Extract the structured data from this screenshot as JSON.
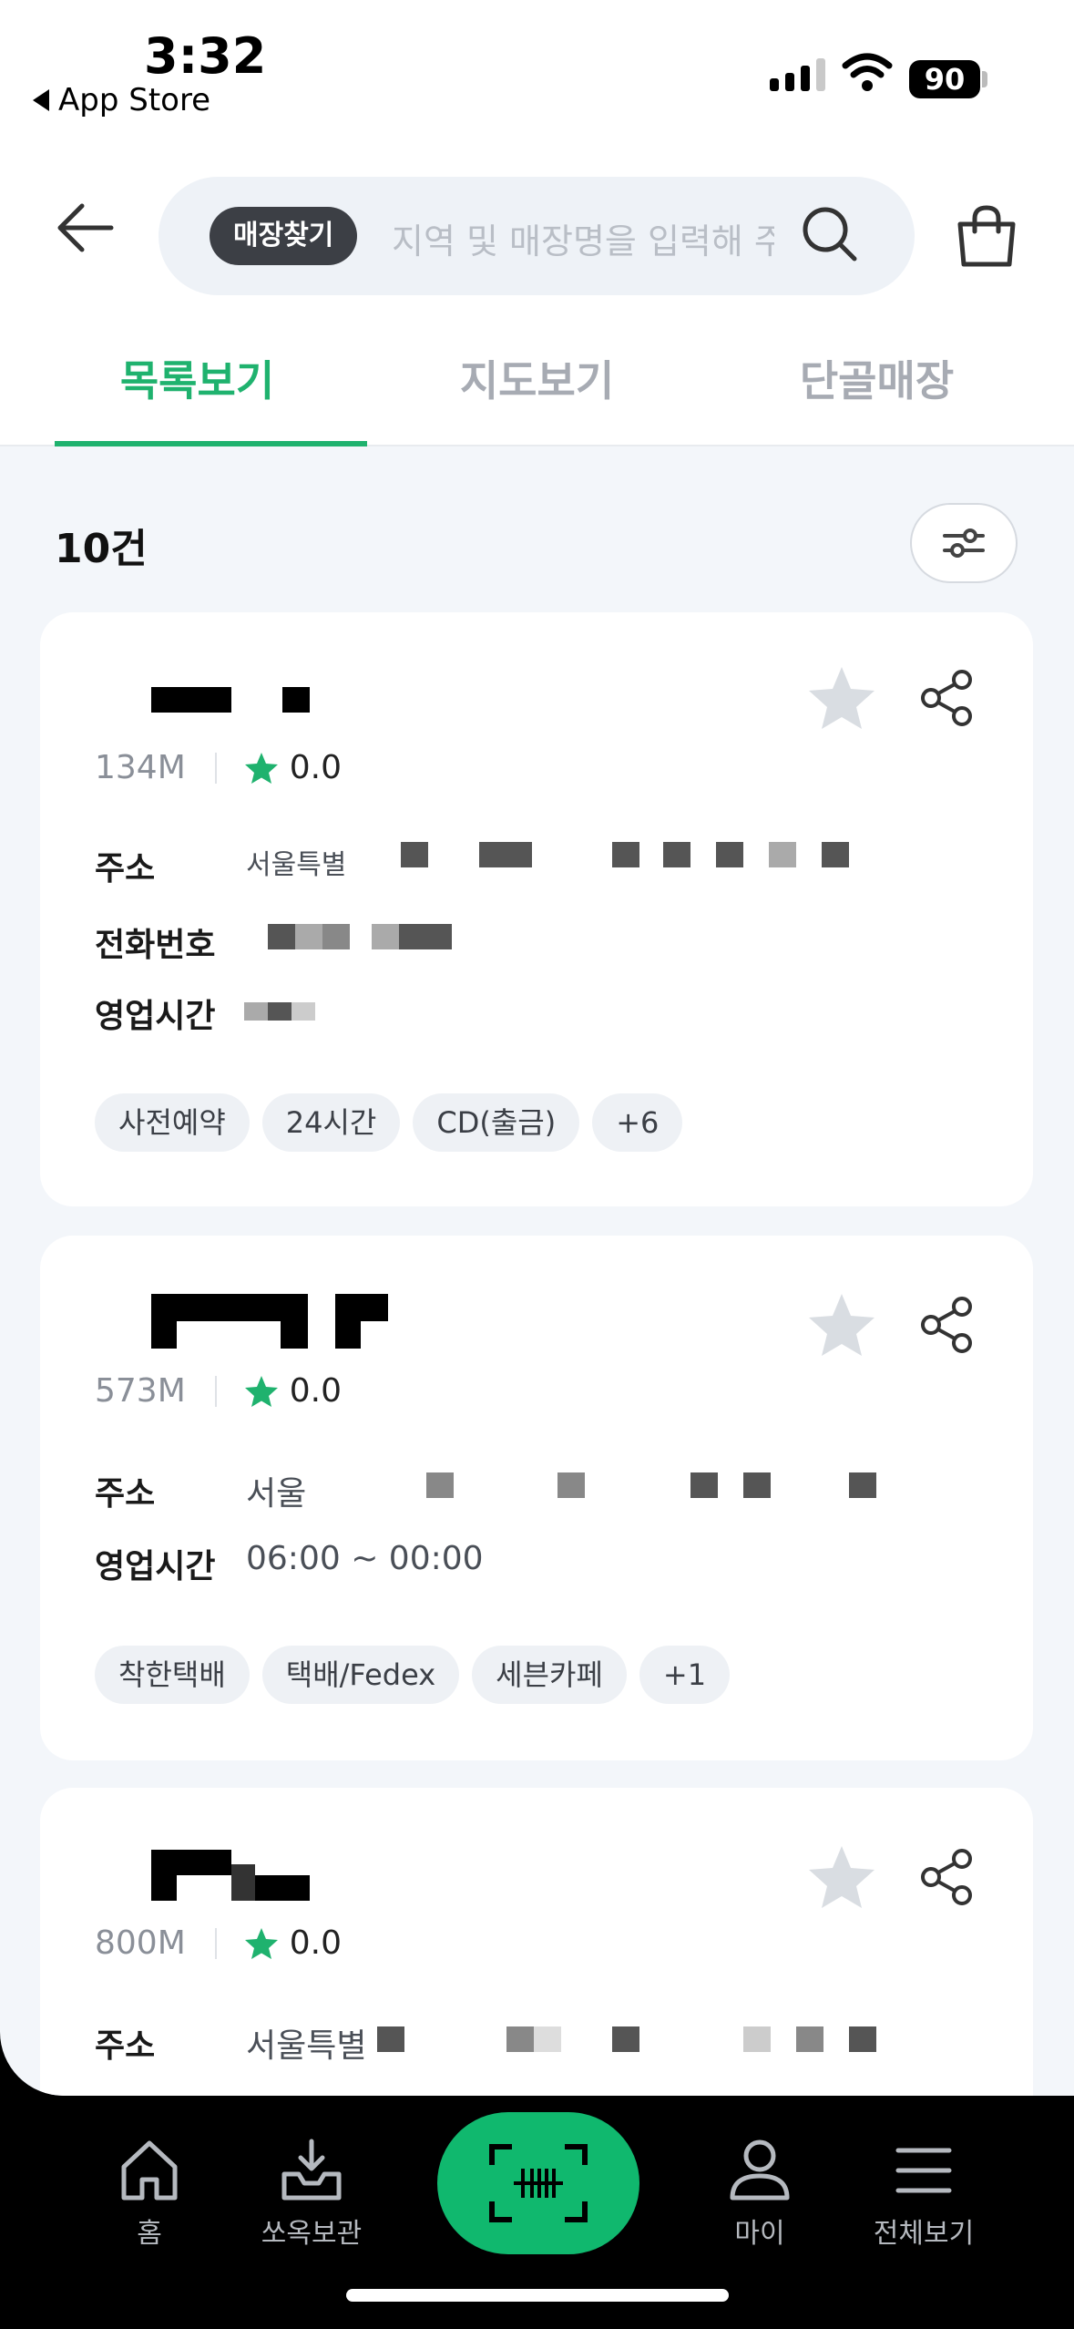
{
  "status_bar": {
    "time": "3:32",
    "back_app": "App Store",
    "battery": "90"
  },
  "header": {
    "find_store_chip": "매장찾기",
    "search_placeholder": "지역 및 매장명을 입력해 주세요"
  },
  "tabs": [
    {
      "label": "목록보기",
      "active": true
    },
    {
      "label": "지도보기",
      "active": false
    },
    {
      "label": "단골매장",
      "active": false
    }
  ],
  "result_count": "10건",
  "stores": [
    {
      "distance": "134M",
      "rating": "0.0",
      "info": [
        {
          "label": "주소",
          "value": "서울특별"
        },
        {
          "label": "전화번호",
          "value": ""
        },
        {
          "label": "영업시간",
          "value": ""
        }
      ],
      "tags": [
        "사전예약",
        "24시간",
        "CD(출금)",
        "+6"
      ]
    },
    {
      "distance": "573M",
      "rating": "0.0",
      "info": [
        {
          "label": "주소",
          "value": "서울"
        },
        {
          "label": "영업시간",
          "value": "06:00 ~ 00:00"
        }
      ],
      "tags": [
        "착한택배",
        "택배/Fedex",
        "세븐카페",
        "+1"
      ]
    },
    {
      "distance": "800M",
      "rating": "0.0",
      "info": [
        {
          "label": "주소",
          "value": "서울특별"
        }
      ],
      "tags": []
    }
  ],
  "bottom_nav": {
    "home": "홈",
    "storage": "쏘옥보관",
    "my": "마이",
    "all": "전체보기"
  },
  "colors": {
    "accent": "#1fb26e",
    "scan": "#10b86e",
    "star_fill": "#d9dde2"
  }
}
